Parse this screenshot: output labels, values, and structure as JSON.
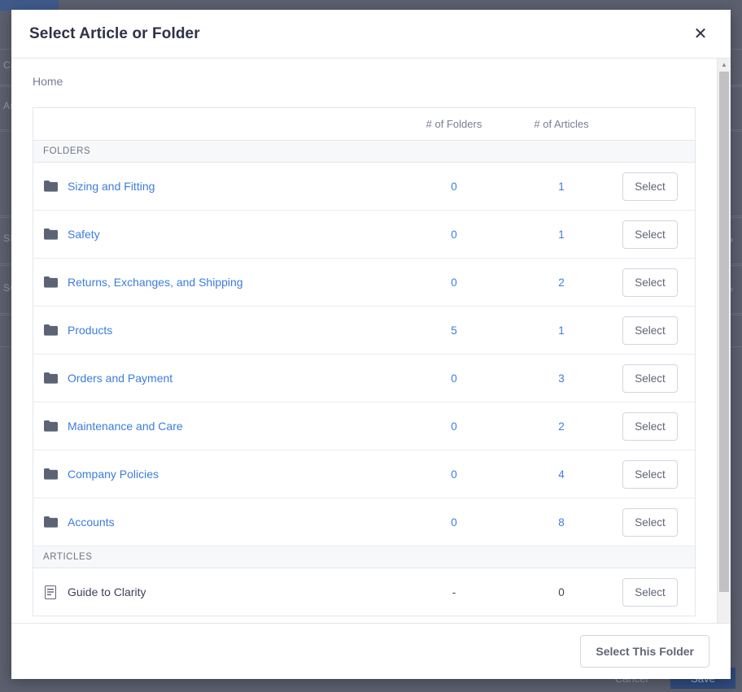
{
  "modal": {
    "title": "Select Article or Folder",
    "close_icon": "close-icon",
    "breadcrumb": "Home",
    "columns": {
      "name": "",
      "folders": "# of Folders",
      "articles": "# of Articles",
      "action": ""
    },
    "sections": [
      {
        "heading": "FOLDERS",
        "rows": [
          {
            "icon": "folder-icon",
            "label": "Sizing and Fitting",
            "folders": "0",
            "articles": "1",
            "action": "Select",
            "is_link": true
          },
          {
            "icon": "folder-icon",
            "label": "Safety",
            "folders": "0",
            "articles": "1",
            "action": "Select",
            "is_link": true
          },
          {
            "icon": "folder-icon",
            "label": "Returns, Exchanges, and Shipping",
            "folders": "0",
            "articles": "2",
            "action": "Select",
            "is_link": true
          },
          {
            "icon": "folder-icon",
            "label": "Products",
            "folders": "5",
            "articles": "1",
            "action": "Select",
            "is_link": true
          },
          {
            "icon": "folder-icon",
            "label": "Orders and Payment",
            "folders": "0",
            "articles": "3",
            "action": "Select",
            "is_link": true
          },
          {
            "icon": "folder-icon",
            "label": "Maintenance and Care",
            "folders": "0",
            "articles": "2",
            "action": "Select",
            "is_link": true
          },
          {
            "icon": "folder-icon",
            "label": "Company Policies",
            "folders": "0",
            "articles": "4",
            "action": "Select",
            "is_link": true
          },
          {
            "icon": "folder-icon",
            "label": "Accounts",
            "folders": "0",
            "articles": "8",
            "action": "Select",
            "is_link": true
          }
        ]
      },
      {
        "heading": "ARTICLES",
        "rows": [
          {
            "icon": "document-icon",
            "label": "Guide to Clarity",
            "folders": "-",
            "articles": "0",
            "action": "Select",
            "is_link": false
          }
        ]
      }
    ],
    "footer": {
      "select_this_folder": "Select This Folder"
    }
  },
  "background": {
    "fragments": [
      "CO",
      "Art",
      "SET",
      "SO"
    ],
    "cancel_label": "Cancel",
    "save_label": "Save"
  },
  "colors": {
    "link": "#3b7ddd",
    "title": "#2e3246",
    "muted": "#787e93",
    "border": "#e4e6ec",
    "section_bg": "#f7f8fa",
    "overlay": "#5b5f6e",
    "save_bg": "#2e4a7d"
  }
}
